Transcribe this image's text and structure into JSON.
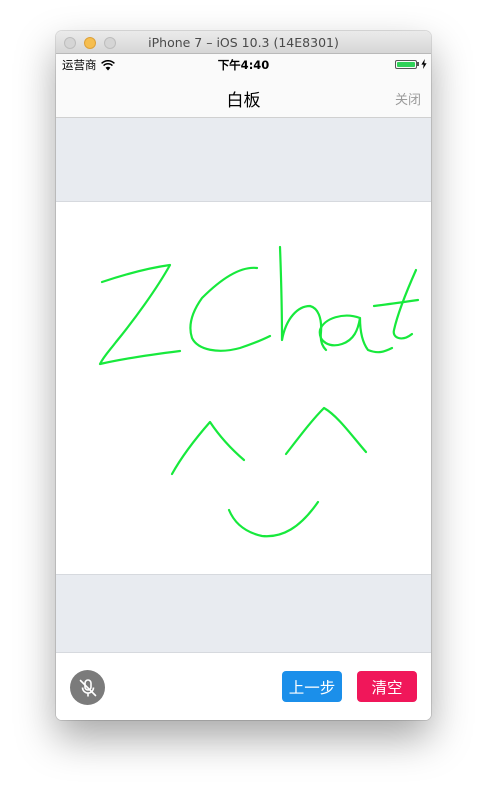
{
  "window": {
    "title": "iPhone 7 – iOS 10.3 (14E8301)"
  },
  "status_bar": {
    "carrier": "运营商",
    "time": "下午4:40",
    "battery_percent": 100,
    "battery_color": "#2fd158"
  },
  "nav": {
    "title": "白板",
    "close_label": "关闭"
  },
  "whiteboard": {
    "stroke_color": "#17e93c",
    "drawing_text": "ZChat ^^ smiley (hand-drawn)"
  },
  "toolbar": {
    "mic_icon": "mic-off-icon",
    "undo_label": "上一步",
    "clear_label": "清空",
    "undo_color": "#1b8fea",
    "clear_color": "#f0175a"
  }
}
